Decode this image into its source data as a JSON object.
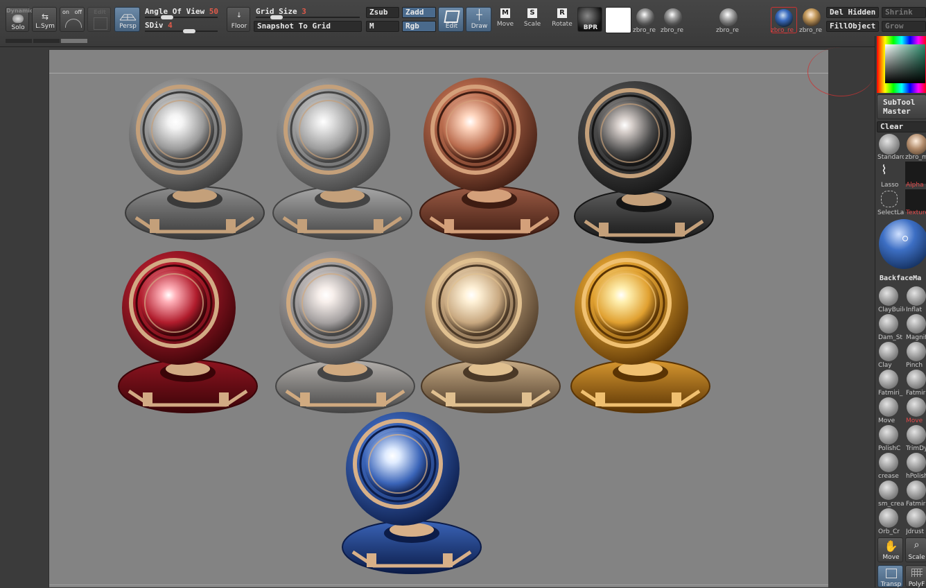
{
  "toolbar": {
    "dynamic_label": "Dynamic",
    "solo_label": "Solo",
    "lsym_label": "L.Sym",
    "on_label": "on",
    "off_label": "off",
    "edit_label": "Edit",
    "persp_label": "Persp",
    "angle_of_view_label": "Angle Of View",
    "angle_of_view_value": "50",
    "sdiv_label": "SDiv",
    "sdiv_value": "4",
    "floor_label": "Floor",
    "grid_size_label": "Grid Size",
    "grid_size_value": "3",
    "snapshot_label": "Snapshot To Grid",
    "zsub_label": "Zsub",
    "zadd_label": "Zadd",
    "m_label": "M",
    "rgb_label": "Rgb",
    "edit_mode_label": "Edit",
    "draw_label": "Draw",
    "move_label": "Move",
    "scale_label": "Scale",
    "rotate_label": "Rotate",
    "move_key": "M",
    "scale_key": "S",
    "rotate_key": "R",
    "bpr_label": "BPR",
    "material1_label": "zbro_re",
    "material2_label": "zbro_re",
    "material3_label": "zbro_re",
    "material4_label": "zbro_re",
    "material5_label": "zbro_re",
    "del_hidden_label": "Del Hidden",
    "fill_object_label": "FillObject",
    "shrink_label": "Shrink",
    "grow_label": "Grow"
  },
  "right_panel": {
    "subtool_master_line1": "SubTool",
    "subtool_master_line2": "Master",
    "clear_label": "Clear",
    "items": [
      {
        "label": "Standard"
      },
      {
        "label": "zbro_m"
      },
      {
        "label": "Lasso"
      },
      {
        "label": "Alpha"
      },
      {
        "label": "SelectLa"
      },
      {
        "label": "Texture"
      }
    ],
    "backface_label": "BackfaceMa",
    "brushes": [
      {
        "label": "ClayBuilc"
      },
      {
        "label": "Inflat"
      },
      {
        "label": "Dam_St"
      },
      {
        "label": "Magnif"
      },
      {
        "label": "Clay"
      },
      {
        "label": "Pinch"
      },
      {
        "label": "Fatmiri_"
      },
      {
        "label": "Fatmiri"
      },
      {
        "label": "Move"
      },
      {
        "label": "Move"
      },
      {
        "label": "PolishC"
      },
      {
        "label": "TrimDy"
      },
      {
        "label": "crease"
      },
      {
        "label": "hPolish"
      },
      {
        "label": "sm_crea"
      },
      {
        "label": "Fatmiri"
      },
      {
        "label": "Orb_Cr"
      },
      {
        "label": "Jdrust"
      }
    ],
    "move_btn_label": "Move",
    "scale_btn_label": "Scale",
    "transp_label": "Transp",
    "polyf_label": "PolyF"
  },
  "colors": {
    "accent_red": "#e05a4a",
    "active_blue": "#4a6a8c",
    "canvas_bg": "#838383"
  },
  "materials": [
    {
      "name": "silver-bright"
    },
    {
      "name": "silver-matte"
    },
    {
      "name": "copper"
    },
    {
      "name": "dark-chrome"
    },
    {
      "name": "red"
    },
    {
      "name": "light-silver"
    },
    {
      "name": "champagne"
    },
    {
      "name": "gold"
    },
    {
      "name": "blue"
    }
  ]
}
